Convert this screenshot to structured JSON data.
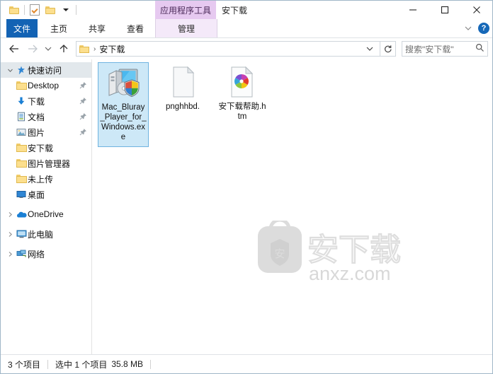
{
  "window": {
    "title": "安下载",
    "contextual_tab_group": "应用程序工具",
    "minimize_icon": "minimize-icon",
    "maximize_icon": "maximize-icon",
    "close_icon": "close-icon"
  },
  "quick_access_toolbar": {
    "items": [
      {
        "name": "folder-icon",
        "label": ""
      },
      {
        "name": "properties-icon",
        "label": ""
      },
      {
        "name": "new-folder-icon",
        "label": ""
      },
      {
        "name": "chevron-down-icon",
        "label": ""
      }
    ]
  },
  "ribbon": {
    "tabs": [
      {
        "label": "文件",
        "active": true
      },
      {
        "label": "主页",
        "active": false
      },
      {
        "label": "共享",
        "active": false
      },
      {
        "label": "查看",
        "active": false
      },
      {
        "label": "管理",
        "active": false,
        "contextual": true
      }
    ],
    "collapse_icon": "chevron-up-icon",
    "help_icon": "help-icon",
    "help_glyph": "?"
  },
  "address_bar": {
    "back_icon": "back-arrow-icon",
    "forward_icon": "forward-arrow-icon",
    "history_icon": "recent-locations-icon",
    "up_icon": "up-arrow-icon",
    "path_folder_icon": "folder-icon",
    "path_separator": "›",
    "path": "安下载",
    "dropdown_icon": "chevron-down-icon",
    "refresh_icon": "refresh-icon",
    "search_placeholder": "搜索\"安下载\"",
    "search_icon": "search-icon"
  },
  "sidebar": {
    "items": [
      {
        "label": "快速访问",
        "icon": "star-pin-icon",
        "level": 0,
        "chevron": "expanded",
        "selected": true,
        "pinned": false
      },
      {
        "label": "Desktop",
        "icon": "folder-icon",
        "level": 1,
        "chevron": "none",
        "selected": false,
        "pinned": true
      },
      {
        "label": "下载",
        "icon": "downloads-icon",
        "level": 1,
        "chevron": "none",
        "selected": false,
        "pinned": true
      },
      {
        "label": "文档",
        "icon": "documents-icon",
        "level": 1,
        "chevron": "none",
        "selected": false,
        "pinned": true
      },
      {
        "label": "图片",
        "icon": "pictures-icon",
        "level": 1,
        "chevron": "none",
        "selected": false,
        "pinned": true
      },
      {
        "label": "安下载",
        "icon": "folder-icon",
        "level": 1,
        "chevron": "none",
        "selected": false,
        "pinned": false
      },
      {
        "label": "图片管理器",
        "icon": "folder-icon",
        "level": 1,
        "chevron": "none",
        "selected": false,
        "pinned": false
      },
      {
        "label": "未上传",
        "icon": "folder-icon",
        "level": 1,
        "chevron": "none",
        "selected": false,
        "pinned": false
      },
      {
        "label": "桌面",
        "icon": "desktop-icon",
        "level": 1,
        "chevron": "none",
        "selected": false,
        "pinned": false
      },
      {
        "label": "OneDrive",
        "icon": "onedrive-cloud-icon",
        "level": 0,
        "chevron": "collapsed",
        "selected": false,
        "pinned": false
      },
      {
        "label": "此电脑",
        "icon": "this-pc-icon",
        "level": 0,
        "chevron": "collapsed",
        "selected": false,
        "pinned": false
      },
      {
        "label": "网络",
        "icon": "network-icon",
        "level": 0,
        "chevron": "collapsed",
        "selected": false,
        "pinned": false
      }
    ]
  },
  "files": [
    {
      "name": "Mac_Bluray_Player_for_Windows.exe",
      "icon": "application-exe-icon",
      "selected": true
    },
    {
      "name": "pnghhbd.",
      "icon": "blank-document-icon",
      "selected": false
    },
    {
      "name": "安下载帮助.htm",
      "icon": "html-document-icon",
      "selected": false
    }
  ],
  "watermark": {
    "text_cn": "安下载",
    "text_domain": "anxz.com",
    "shield_glyph": "安"
  },
  "status_bar": {
    "item_count": "3 个项目",
    "selection": "选中 1 个项目",
    "size": "35.8 MB"
  },
  "colors": {
    "accent_blue": "#1363b4",
    "contextual_purple": "#e6c9f0",
    "contextual_tab_bg": "#f4e9f9",
    "selection_blue": "#cde8f7",
    "folder_yellow": "#fcdf8e"
  }
}
